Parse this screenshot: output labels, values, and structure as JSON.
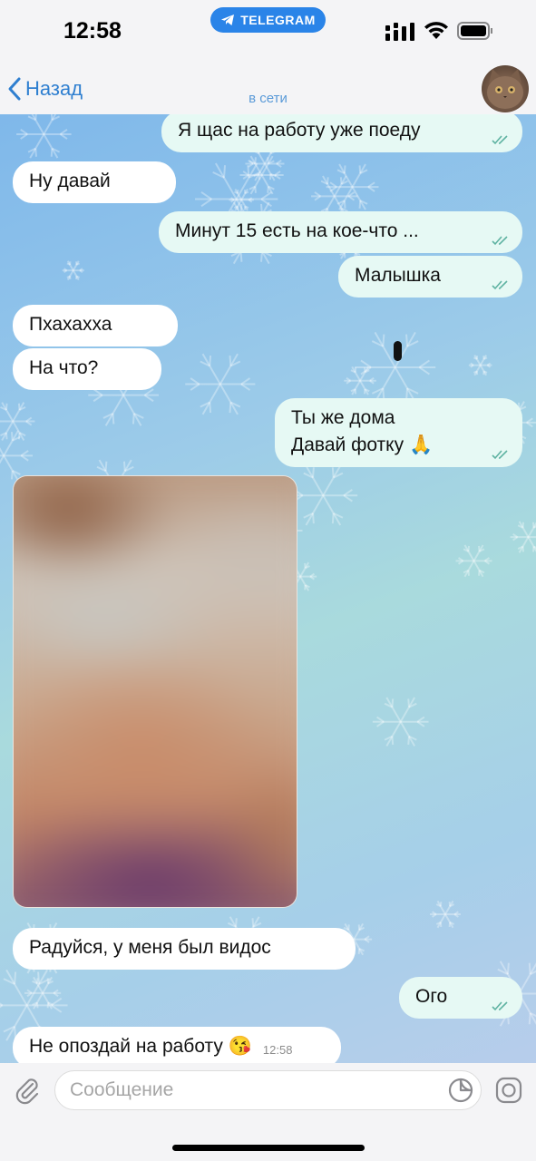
{
  "status_bar": {
    "time": "12:58",
    "app_badge": "TELEGRAM",
    "icons": [
      "telegram-plane-icon",
      "signal-icon",
      "wifi-icon",
      "battery-icon"
    ]
  },
  "header": {
    "back_label": "Назад",
    "status": "в сети",
    "icons": [
      "chevron-left-icon",
      "avatar"
    ]
  },
  "messages": [
    {
      "side": "out",
      "text": "Я щас на работу уже поеду",
      "read": true
    },
    {
      "side": "in",
      "text": "Ну давай"
    },
    {
      "side": "out",
      "text": "Минут 15 есть на кое-что ...",
      "read": true
    },
    {
      "side": "out",
      "text": "Малышка",
      "read": true
    },
    {
      "side": "in",
      "text": "Пхахахха"
    },
    {
      "side": "in",
      "text": "На что?"
    },
    {
      "side": "out",
      "line1": "Ты же дома",
      "line2": "Давай фотку 🙏",
      "read": true
    },
    {
      "side": "in",
      "type": "photo",
      "blurred": true
    },
    {
      "side": "in",
      "text": "Радуйся, у меня был видос"
    },
    {
      "side": "out",
      "text": "Ого",
      "read": true
    },
    {
      "side": "in",
      "text": "Не опоздай на работу 😘",
      "time": "12:58"
    }
  ],
  "input_bar": {
    "placeholder": "Сообщение",
    "value": "",
    "icons": [
      "paperclip-icon",
      "sticker-icon",
      "camera-icon"
    ]
  },
  "colors": {
    "accent": "#2f7fd0",
    "telegram_badge": "#2a84e8",
    "outgoing_bubble": "#e6f9f4",
    "incoming_bubble": "#ffffff",
    "read_ticks": "#5fb3a2",
    "chat_bg_start": "#7fb8ea",
    "chat_bg_end": "#b7cdeb"
  }
}
